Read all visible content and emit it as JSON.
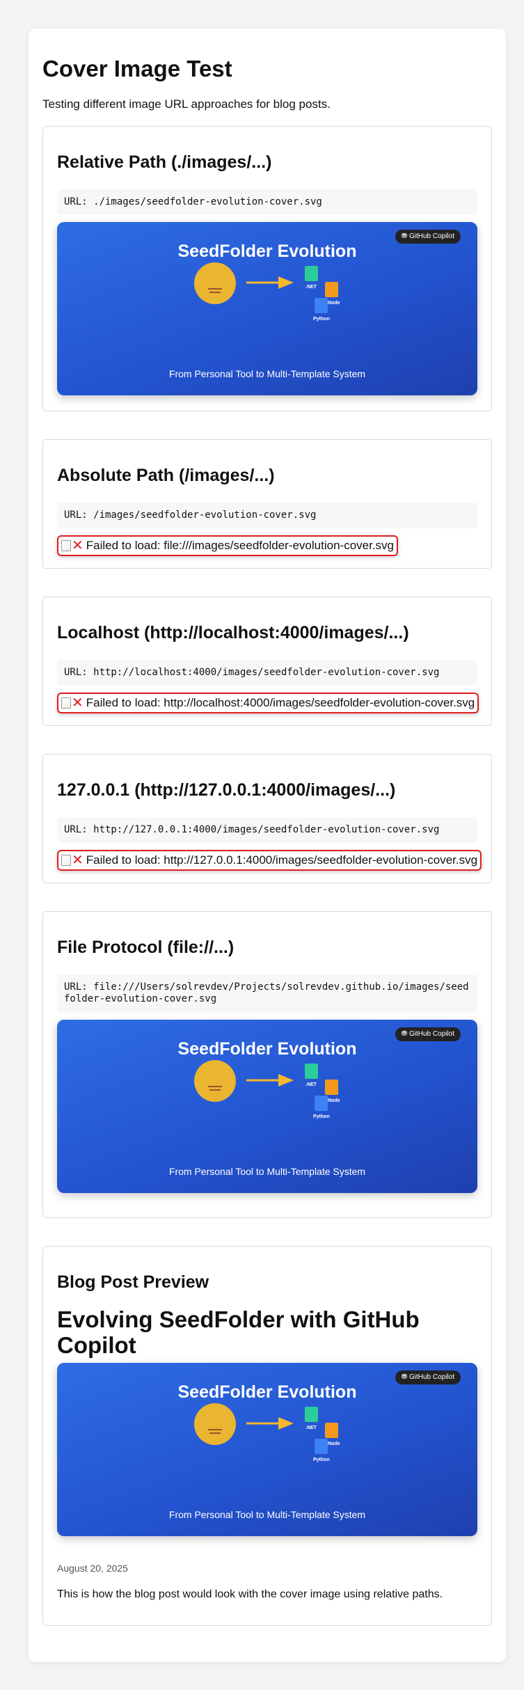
{
  "page": {
    "title": "Cover Image Test",
    "intro": "Testing different image URL approaches for blog posts."
  },
  "cover_art": {
    "title": "SeedFolder Evolution",
    "subtitle": "From Personal Tool to Multi-Template System",
    "badge": "GitHub Copilot",
    "tiles": [
      ".NET",
      "Node",
      "Python"
    ],
    "colors": {
      "bg_top": "#2f6de3",
      "bg_bottom": "#1e40af",
      "seed": "#eab530",
      "arrow": "#f5b82e",
      "net": "#2dcc9b",
      "node": "#f29a1e",
      "python": "#3b82f6"
    }
  },
  "tests": [
    {
      "heading": "Relative Path (./images/...)",
      "url": "URL: ./images/seedfolder-evolution-cover.svg",
      "status": "loaded"
    },
    {
      "heading": "Absolute Path (/images/...)",
      "url": "URL: /images/seedfolder-evolution-cover.svg",
      "status": "failed",
      "error": "Failed to load: file:///images/seedfolder-evolution-cover.svg"
    },
    {
      "heading": "Localhost (http://localhost:4000/images/...)",
      "url": "URL: http://localhost:4000/images/seedfolder-evolution-cover.svg",
      "status": "failed",
      "error": "Failed to load: http://localhost:4000/images/seedfolder-evolution-cover.svg"
    },
    {
      "heading": "127.0.0.1 (http://127.0.0.1:4000/images/...)",
      "url": "URL: http://127.0.0.1:4000/images/seedfolder-evolution-cover.svg",
      "status": "failed",
      "error": "Failed to load: http://127.0.0.1:4000/images/seedfolder-evolution-cover.svg"
    },
    {
      "heading": "File Protocol (file://...)",
      "url": "URL: file:///Users/solrevdev/Projects/solrevdev.github.io/images/seedfolder-evolution-cover.svg",
      "status": "loaded"
    }
  ],
  "blog": {
    "label": "Blog Post Preview",
    "title": "Evolving SeedFolder with GitHub Copilot",
    "date": "August 20, 2025",
    "text": "This is how the blog post would look with the cover image using relative paths."
  },
  "icons": {
    "failed": "cross-mark-icon",
    "broken_image": "broken-image-icon",
    "badge": "copilot-icon"
  }
}
